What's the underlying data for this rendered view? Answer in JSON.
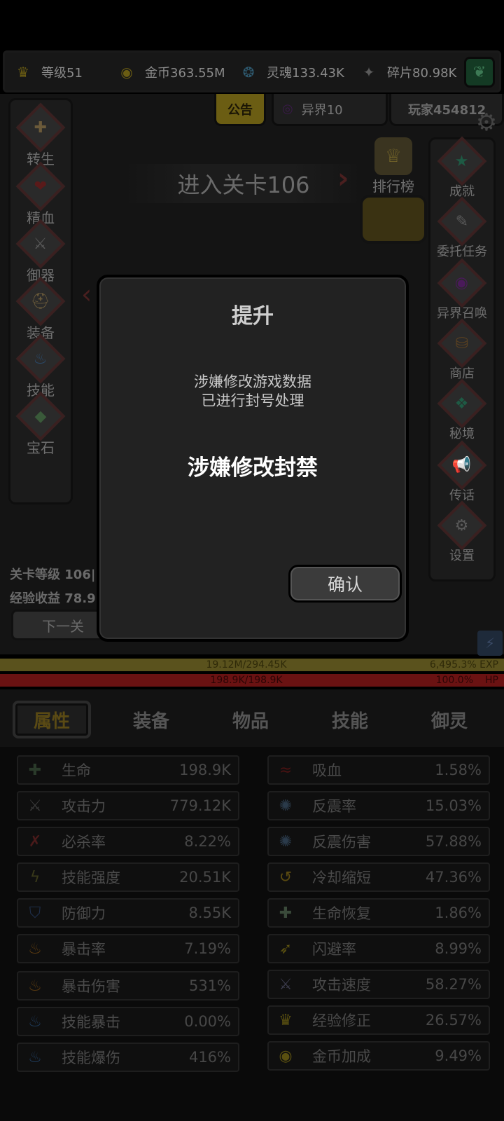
{
  "colors": {
    "accent_gold": "#6b5d13",
    "hp_red": "#6a1212",
    "exp_yellow": "#5a521d",
    "dialog_bg": "#222222"
  },
  "resources": [
    {
      "icon": "crown-icon",
      "label": "等级51"
    },
    {
      "icon": "gold-coin-icon",
      "label": "金币363.55M"
    },
    {
      "icon": "soul-icon",
      "label": "灵魂133.43K"
    },
    {
      "icon": "shard-icon",
      "label": "碎片80.98K"
    }
  ],
  "top_tabs": {
    "notice": "公告",
    "world": "异界10",
    "player": "玩家454812"
  },
  "left_menu": [
    {
      "label": "转生",
      "icon": "rebirth-icon"
    },
    {
      "label": "精血",
      "icon": "blood-icon"
    },
    {
      "label": "御器",
      "icon": "artifact-icon"
    },
    {
      "label": "装备",
      "icon": "equipment-icon"
    },
    {
      "label": "技能",
      "icon": "skill-flame-icon"
    },
    {
      "label": "宝石",
      "icon": "gem-icon"
    }
  ],
  "right_menu": [
    {
      "label": "成就",
      "icon": "star-icon"
    },
    {
      "label": "委托任务",
      "icon": "commission-icon"
    },
    {
      "label": "异界召唤",
      "icon": "summon-portal-icon"
    },
    {
      "label": "商店",
      "icon": "shop-bag-icon"
    },
    {
      "label": "秘境",
      "icon": "secret-realm-icon"
    },
    {
      "label": "传话",
      "icon": "megaphone-icon"
    },
    {
      "label": "设置",
      "icon": "settings-gear-icon"
    }
  ],
  "stage": {
    "enter_label": "进入关卡106",
    "ranking_label": "排行榜",
    "level_label": "关卡等级 106|",
    "exp_gain_label": "经验收益 78.9"
  },
  "bottom_buttons": {
    "next": "下一关"
  },
  "bars": {
    "exp_text": "19.12M/294.45K",
    "exp_percent": "6,495.3% EXP",
    "hp_text": "198.9K/198.9K",
    "hp_percent": "100.0%",
    "hp_tag": "HP"
  },
  "panel_tabs": [
    "属性",
    "装备",
    "物品",
    "技能",
    "御灵"
  ],
  "active_tab": "属性",
  "stats_left": [
    {
      "name": "生命",
      "value": "198.9K",
      "icon": "life-cross-icon"
    },
    {
      "name": "攻击力",
      "value": "779.12K",
      "icon": "sword-icon"
    },
    {
      "name": "必杀率",
      "value": "8.22%",
      "icon": "crit-slash-icon"
    },
    {
      "name": "技能强度",
      "value": "20.51K",
      "icon": "lightning-icon"
    },
    {
      "name": "防御力",
      "value": "8.55K",
      "icon": "shield-icon"
    },
    {
      "name": "暴击率",
      "value": "7.19%",
      "icon": "flame-icon"
    },
    {
      "name": "暴击伤害",
      "value": "531%",
      "icon": "flame-icon"
    },
    {
      "name": "技能暴击",
      "value": "0.00%",
      "icon": "blue-flame-icon"
    },
    {
      "name": "技能爆伤",
      "value": "416%",
      "icon": "blue-flame-icon"
    }
  ],
  "stats_right": [
    {
      "name": "吸血",
      "value": "1.58%",
      "icon": "bat-icon"
    },
    {
      "name": "反震率",
      "value": "15.03%",
      "icon": "reflect-icon"
    },
    {
      "name": "反震伤害",
      "value": "57.88%",
      "icon": "reflect-icon"
    },
    {
      "name": "冷却缩短",
      "value": "47.36%",
      "icon": "cooldown-icon"
    },
    {
      "name": "生命恢复",
      "value": "1.86%",
      "icon": "regen-icon"
    },
    {
      "name": "闪避率",
      "value": "8.99%",
      "icon": "wing-boot-icon"
    },
    {
      "name": "攻击速度",
      "value": "58.27%",
      "icon": "speed-sword-icon"
    },
    {
      "name": "经验修正",
      "value": "26.57%",
      "icon": "crown-icon"
    },
    {
      "name": "金币加成",
      "value": "9.49%",
      "icon": "gold-coin-icon"
    }
  ],
  "dialog": {
    "title": "提升",
    "message_line1": "涉嫌修改游戏数据",
    "message_line2": "已进行封号处理",
    "ban_text": "涉嫌修改封禁",
    "confirm": "确认"
  }
}
